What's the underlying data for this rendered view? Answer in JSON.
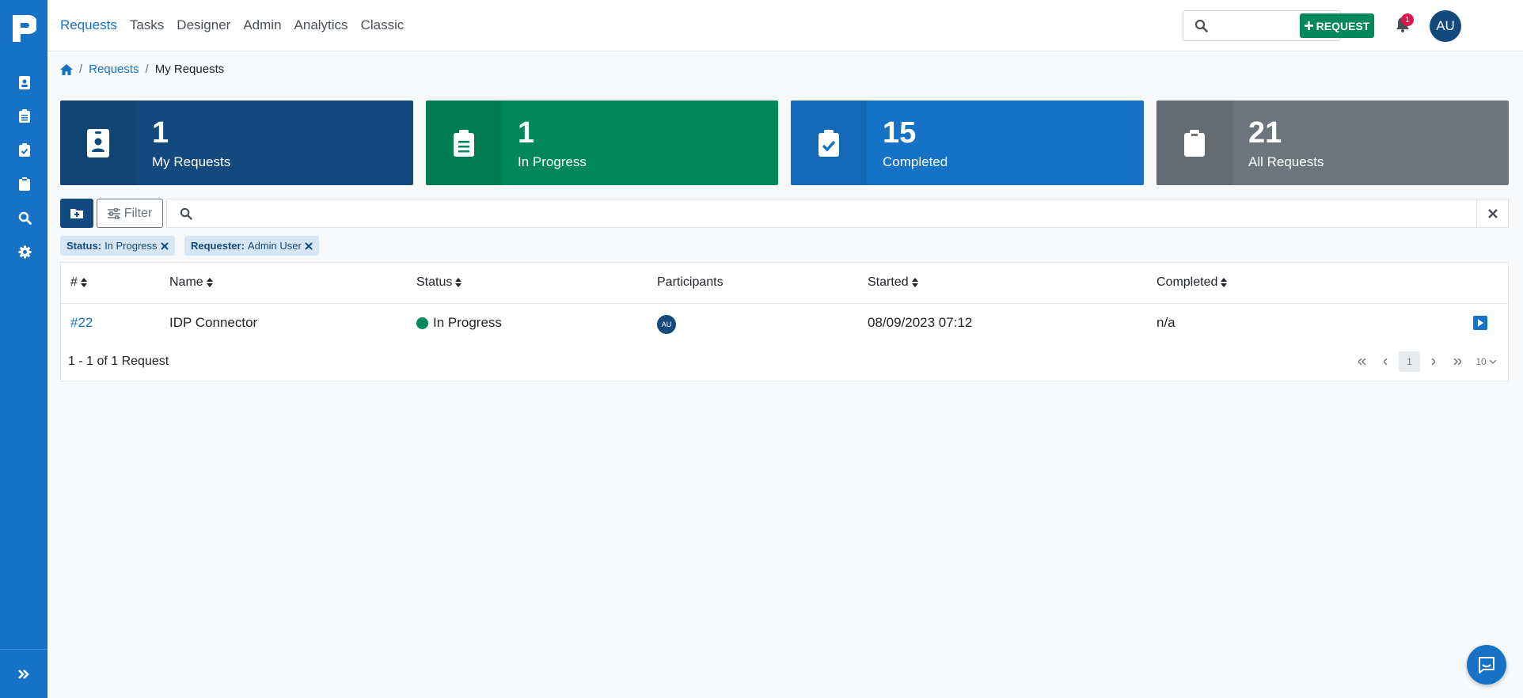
{
  "nav": {
    "items": [
      "Requests",
      "Tasks",
      "Designer",
      "Admin",
      "Analytics",
      "Classic"
    ],
    "active": "Requests"
  },
  "header": {
    "search_value": "",
    "request_button_label": "REQUEST",
    "notification_count": "1",
    "user_initials": "AU"
  },
  "breadcrumb": {
    "items": [
      "Requests",
      "My Requests"
    ]
  },
  "cards": [
    {
      "count": "1",
      "label": "My Requests",
      "color": "#134a7d"
    },
    {
      "count": "1",
      "label": "In Progress",
      "color": "#00875a"
    },
    {
      "count": "15",
      "label": "Completed",
      "color": "#1572c6"
    },
    {
      "count": "21",
      "label": "All Requests",
      "color": "#6c757d"
    }
  ],
  "toolbar": {
    "filter_label": "Filter",
    "search_value": ""
  },
  "filters": [
    {
      "key": "Status:",
      "value": "In Progress"
    },
    {
      "key": "Requester:",
      "value": "Admin User"
    }
  ],
  "table": {
    "columns": [
      "#",
      "Name",
      "Status",
      "Participants",
      "Started",
      "Completed"
    ],
    "rows": [
      {
        "id": "#22",
        "name": "IDP Connector",
        "status": "In Progress",
        "participant_initials": "AU",
        "started": "08/09/2023 07:12",
        "completed": "n/a"
      }
    ],
    "footer": "1 - 1 of 1 Request"
  },
  "pagination": {
    "current_page": "1",
    "page_size": "10"
  },
  "colors": {
    "primary": "#1572c6",
    "success": "#00875a",
    "dark": "#134a7d",
    "gray": "#6c757d"
  }
}
